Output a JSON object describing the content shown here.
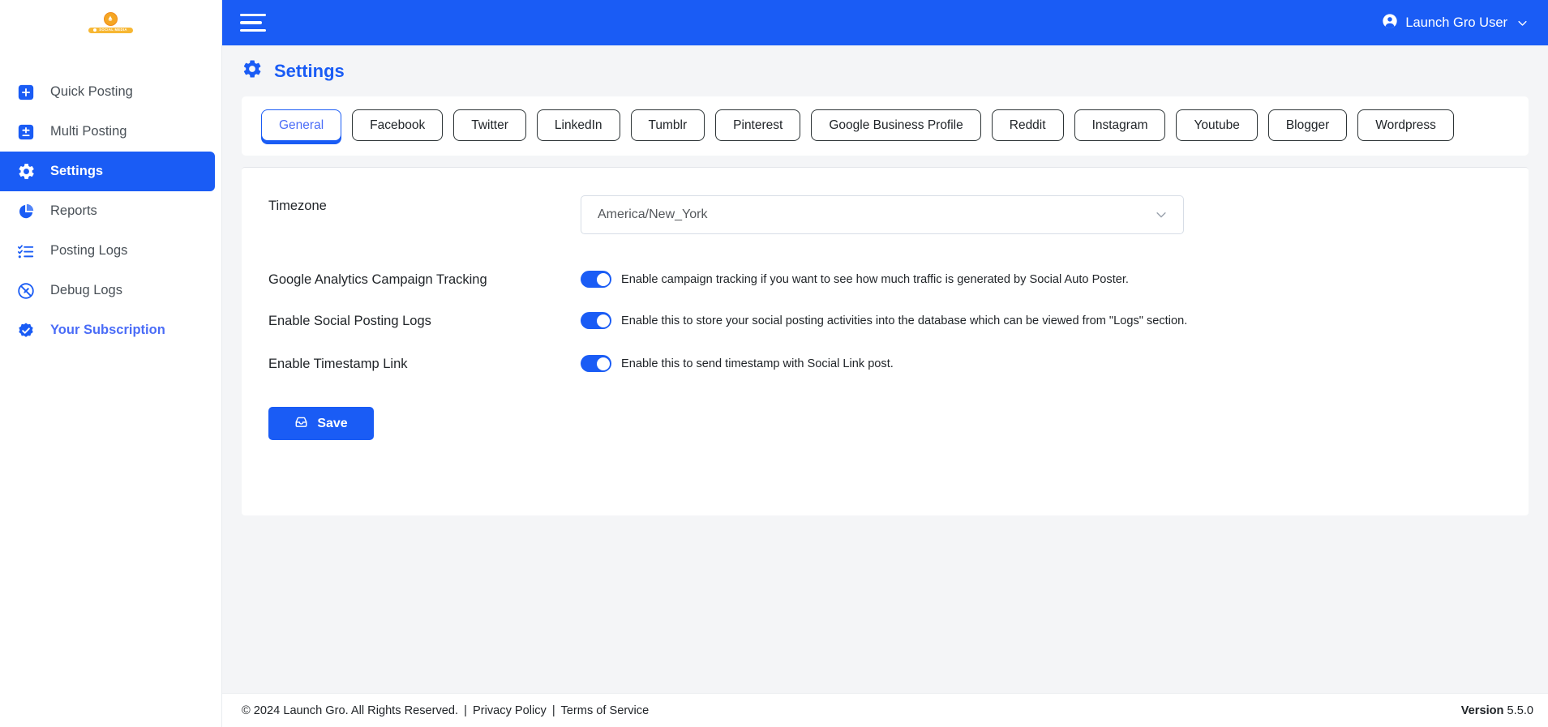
{
  "brand": {
    "logo_text": "SOCIAL MEDIA",
    "accent_blue": "#1a5cf5",
    "link_blue": "#4a6cf7",
    "logo_orange": "#f7b733"
  },
  "sidebar": {
    "items": [
      {
        "label": "Quick Posting",
        "icon": "plus-square-icon",
        "active": false,
        "accent": false
      },
      {
        "label": "Multi Posting",
        "icon": "plus-minus-square-icon",
        "active": false,
        "accent": false
      },
      {
        "label": "Settings",
        "icon": "gear-icon",
        "active": true,
        "accent": false
      },
      {
        "label": "Reports",
        "icon": "pie-chart-icon",
        "active": false,
        "accent": false
      },
      {
        "label": "Posting Logs",
        "icon": "checklist-icon",
        "active": false,
        "accent": false
      },
      {
        "label": "Debug Logs",
        "icon": "no-entry-pen-icon",
        "active": false,
        "accent": false
      },
      {
        "label": "Your Subscription",
        "icon": "verified-check-icon",
        "active": false,
        "accent": true
      }
    ]
  },
  "topbar": {
    "menu_toggle": "hamburger-menu",
    "user_name": "Launch Gro User"
  },
  "page": {
    "title": "Settings",
    "title_icon": "gear-icon"
  },
  "tabs": [
    {
      "label": "General",
      "active": true
    },
    {
      "label": "Facebook",
      "active": false
    },
    {
      "label": "Twitter",
      "active": false
    },
    {
      "label": "LinkedIn",
      "active": false
    },
    {
      "label": "Tumblr",
      "active": false
    },
    {
      "label": "Pinterest",
      "active": false
    },
    {
      "label": "Google Business Profile",
      "active": false
    },
    {
      "label": "Reddit",
      "active": false
    },
    {
      "label": "Instagram",
      "active": false
    },
    {
      "label": "Youtube",
      "active": false
    },
    {
      "label": "Blogger",
      "active": false
    },
    {
      "label": "Wordpress",
      "active": false
    }
  ],
  "form": {
    "timezone": {
      "label": "Timezone",
      "value": "America/New_York"
    },
    "google_analytics": {
      "label": "Google Analytics Campaign Tracking",
      "description": "Enable campaign tracking if you want to see how much traffic is generated by Social Auto Poster.",
      "enabled": true
    },
    "social_posting_logs": {
      "label": "Enable Social Posting Logs",
      "description": "Enable this to store your social posting activities into the database which can be viewed from \"Logs\" section.",
      "enabled": true
    },
    "timestamp_link": {
      "label": "Enable Timestamp Link",
      "description": "Enable this to send timestamp with Social Link post.",
      "enabled": true
    },
    "save_label": "Save",
    "save_icon": "inbox-tray-icon"
  },
  "footer": {
    "copyright": "© 2024 Launch Gro. All Rights Reserved.",
    "separator": "|",
    "privacy": "Privacy Policy",
    "terms": "Terms of Service",
    "version_label": "Version",
    "version_number": "5.5.0"
  }
}
